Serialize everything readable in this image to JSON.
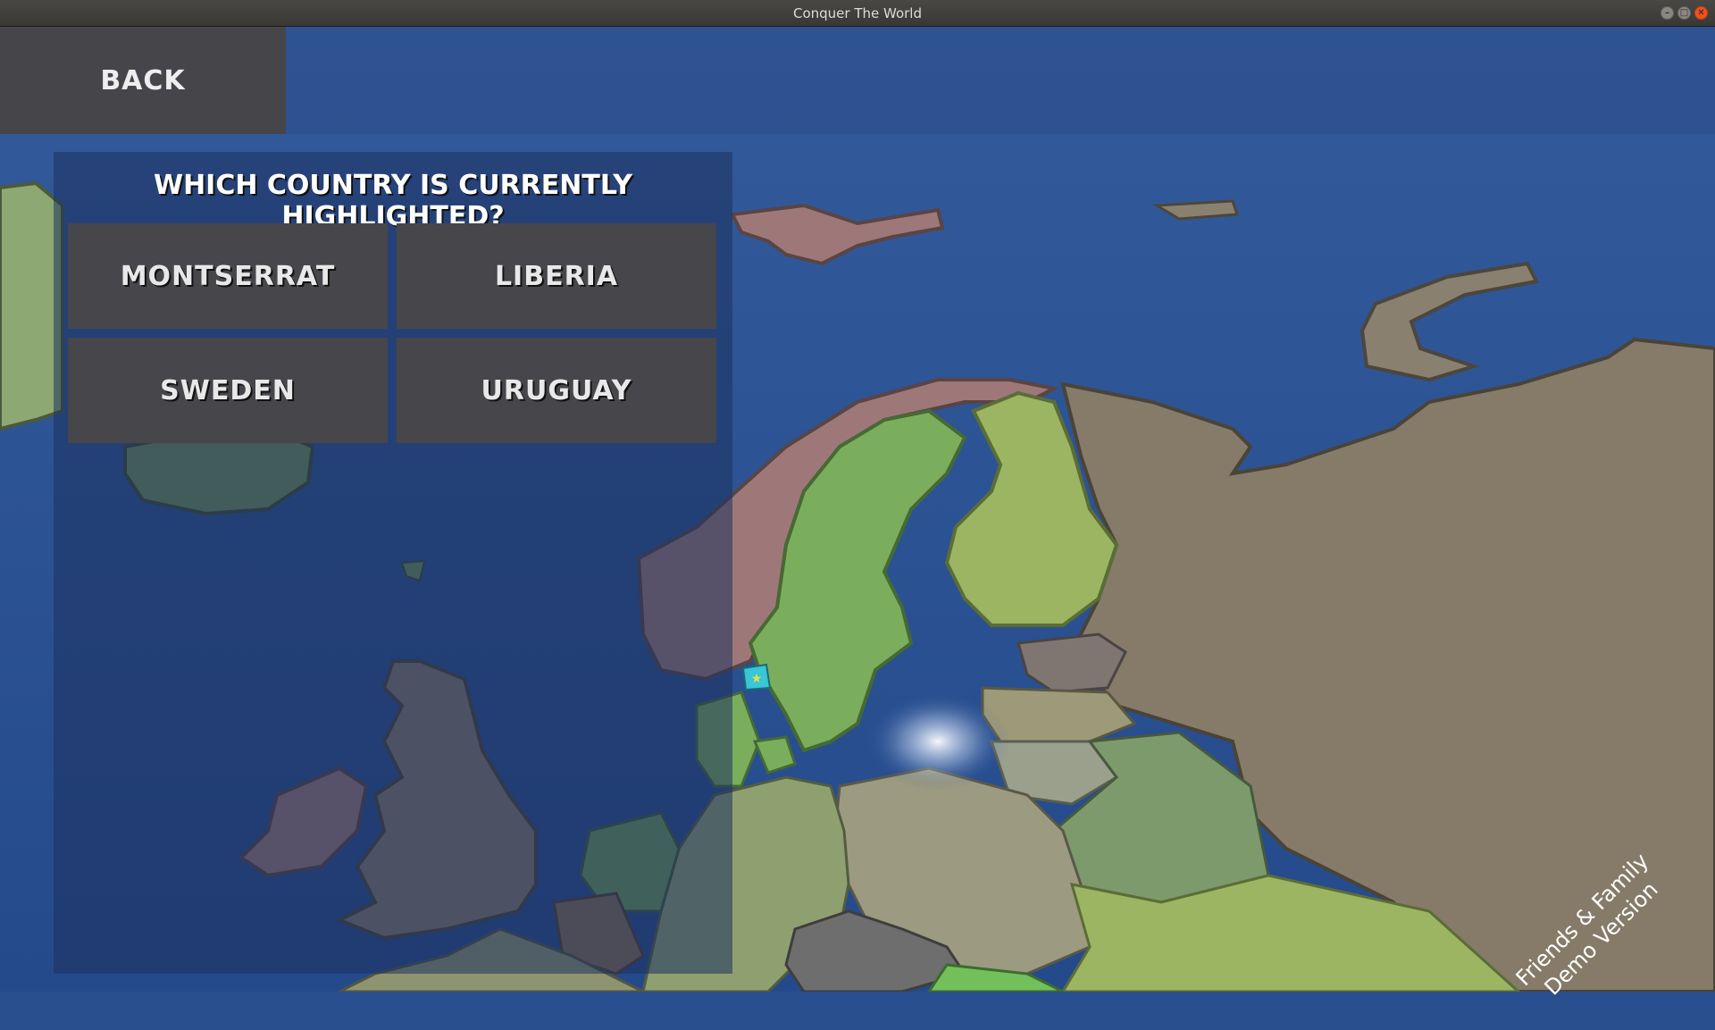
{
  "window": {
    "title": "Conquer The World"
  },
  "nav": {
    "back_label": "BACK"
  },
  "quiz": {
    "question": "WHICH COUNTRY IS CURRENTLY HIGHLIGHTED?",
    "answers": [
      "MONTSERRAT",
      "LIBERIA",
      "SWEDEN",
      "URUGUAY"
    ]
  },
  "watermark": {
    "line1": "Friends & Family",
    "line2": "Demo Version"
  },
  "colors": {
    "ocean": "#2a4f8f",
    "button_bg": "#47464b",
    "russia": "#857b68",
    "sweden": "#7aae5c",
    "finland": "#9cb562",
    "norway": "#9e7878",
    "highlight_marker": "#39c6d6"
  }
}
